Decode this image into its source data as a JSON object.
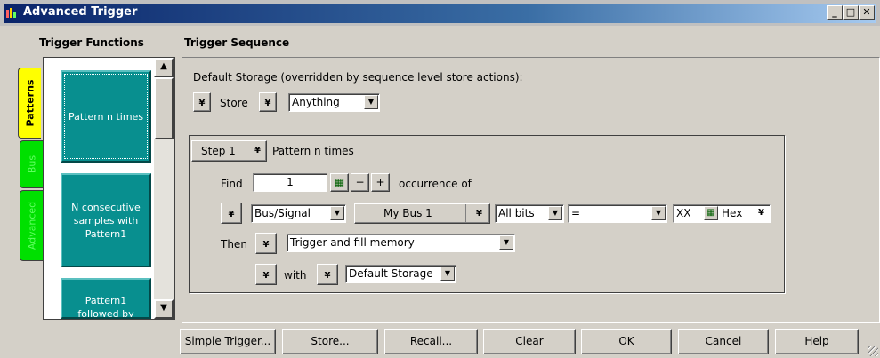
{
  "window": {
    "title": "Advanced Trigger"
  },
  "headers": {
    "functions": "Trigger Functions",
    "sequence": "Trigger Sequence"
  },
  "tabs": [
    {
      "label": "Patterns",
      "color": "#ffff00"
    },
    {
      "label": "Bus",
      "color": "#00e000"
    },
    {
      "label": "Advanced",
      "color": "#00e000"
    }
  ],
  "functions": [
    {
      "label": "Pattern n times"
    },
    {
      "label": "N consecutive samples with Pattern1"
    },
    {
      "label": "Pattern1 followed by"
    }
  ],
  "default_storage": {
    "label": "Default Storage (overridden by sequence level store actions):",
    "store_label": "Store",
    "store_value": "Anything"
  },
  "step": {
    "step_label": "Step 1",
    "name": "Pattern n times",
    "find_label": "Find",
    "find_value": "1",
    "occurrence_label": "occurrence of",
    "signal_select": "Bus/Signal",
    "bus_name": "My Bus 1",
    "bits_select": "All bits",
    "operator_select": "=",
    "value": "XX",
    "radix": "Hex",
    "then_label": "Then",
    "action_select": "Trigger and fill memory",
    "with_label": "with",
    "storage_select": "Default Storage"
  },
  "buttons": {
    "simple_trigger": "Simple Trigger...",
    "store": "Store...",
    "recall": "Recall...",
    "clear": "Clear",
    "ok": "OK",
    "cancel": "Cancel",
    "help": "Help"
  }
}
